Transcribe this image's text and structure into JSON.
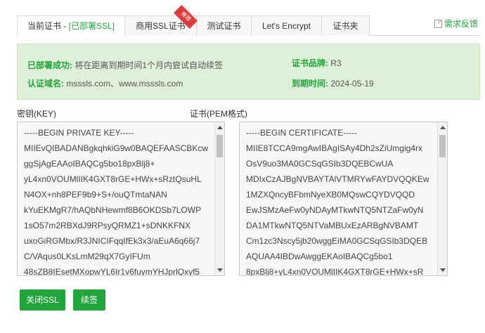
{
  "tabs": [
    {
      "label_prefix": "当前证书 - ",
      "label_status": "[已部署SSL]"
    },
    {
      "label": "商用SSL证书",
      "badge": "推荐"
    },
    {
      "label": "测试证书"
    },
    {
      "label": "Let's Encrypt"
    },
    {
      "label": "证书夹"
    }
  ],
  "feedback": {
    "label": "需求反馈"
  },
  "info": {
    "deploy_label": "已部署成功:",
    "deploy_value": "将在距离到期时间1个月内尝试自动续签",
    "brand_label": "证书品牌:",
    "brand_value": "R3",
    "domain_label": "认证域名:",
    "domain_value": "msssls.com、www.msssls.com",
    "expire_label": "到期时间:",
    "expire_value": "2024-05-19"
  },
  "key": {
    "label": "密钥(KEY)",
    "lines": [
      "-----BEGIN PRIVATE KEY-----",
      "MIIEvQIBADANBgkqhkiG9w0BAQEFAASCBKcw",
      "ggSjAgEAAoIBAQCg5bo18pxBlj8+",
      "yL4xn0VOUMlIIK4GXT8rGE+HWx+sRztQsuHL",
      "N4OX+nh8PEF9b9+S+/ouQTmtaNAN",
      "kYuEKMgR7/hAQbNHewmf8B6OKDSb7LOWP",
      "1sO57m2RBXdJ9RPsyQRMZ1+sDNKKFNX",
      "uxoGiRGMbx/R3JNICIFqqIfEk3x3/aEuA6q66j7",
      "C/VAqus0LKsLmM29qX7GyIFUm",
      "48sZB8IEsetMXopwYL6Ir1v6fuymYHJprlQxyf5"
    ]
  },
  "cert": {
    "label": "证书(PEM格式)",
    "lines": [
      "-----BEGIN CERTIFICATE-----",
      "MIIE8TCCA9mgAwIBAgISAy4Dh2sZiUmgig4rx",
      "OsV9uo3MA0GCSqGSIb3DQEBCwUA",
      "MDIxCzAJBgNVBAYTAlVTMRYwFAYDVQQKEw",
      "1MZXQncyBFbmNyeXB0MQswCQYDVQQD",
      "EwJSMzAeFw0yNDAyMTkwNTQ5NTZaFw0yN",
      "DA1MTkwNTQ5NTVaMBUxEzARBgNVBAMT",
      "Cm1zc3Nscy5jb20wggEiMA0GCSqGSIb3DQEB",
      "AQUAA4IBDwAwggEKAoIBAQCg5bo1",
      "8pxBlj8+yL4xn0VOUMlIIK4GXT8rGE+HWx+sR"
    ]
  },
  "buttons": {
    "close_ssl": "关闭SSL",
    "renew": "续签"
  },
  "colors": {
    "accent": "#20a53a",
    "info_bg": "#dff0d8",
    "badge": "#e4393c"
  }
}
